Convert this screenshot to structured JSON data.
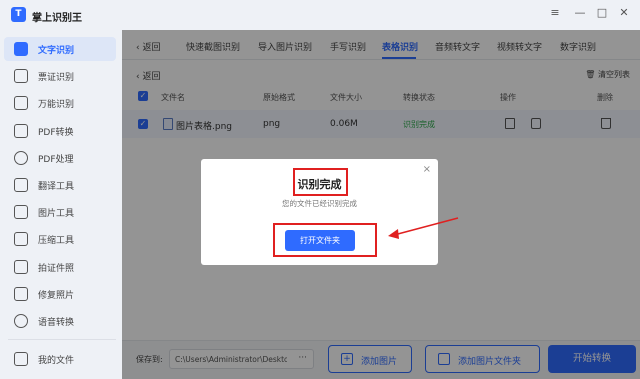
{
  "app": {
    "title": "掌上识别王",
    "logo_glyph": "T",
    "accent": "#2f6bff"
  },
  "window_controls": {
    "menu": "≡",
    "minimize": "—",
    "maximize": "□",
    "close": "✕"
  },
  "sidebar": {
    "items": [
      {
        "label": "文字识别",
        "active": true
      },
      {
        "label": "票证识别"
      },
      {
        "label": "万能识别"
      },
      {
        "label": "PDF转换"
      },
      {
        "label": "PDF处理"
      },
      {
        "label": "翻译工具"
      },
      {
        "label": "图片工具"
      },
      {
        "label": "压缩工具"
      },
      {
        "label": "拍证件照"
      },
      {
        "label": "修复照片"
      },
      {
        "label": "语音转换"
      }
    ],
    "my_files": "我的文件"
  },
  "tabs": {
    "back": "返回",
    "items": [
      "快速截图识别",
      "导入图片识别",
      "手写识别",
      "表格识别",
      "音频转文字",
      "视频转文字",
      "数字识别"
    ],
    "active": "表格识别"
  },
  "subheader": {
    "back": "返回",
    "clear_list": "清空列表"
  },
  "table": {
    "columns": [
      "文件名",
      "原始格式",
      "文件大小",
      "转换状态",
      "操作",
      "删除"
    ],
    "rows": [
      {
        "filename": "图片表格.png",
        "format": "png",
        "size": "0.06M",
        "status": "识别完成",
        "status_color": "#2eaa4c"
      }
    ]
  },
  "bottom": {
    "save_label": "保存到:",
    "save_path": "C:\\Users\\Administrator\\Deskto...",
    "path_more": "···",
    "add_image": "添加图片",
    "add_folder": "添加图片文件夹",
    "start": "开始转换"
  },
  "modal": {
    "title": "识别完成",
    "message": "您的文件已经识别完成",
    "button": "打开文件夹",
    "close": "×",
    "highlight_color": "#e02020"
  }
}
